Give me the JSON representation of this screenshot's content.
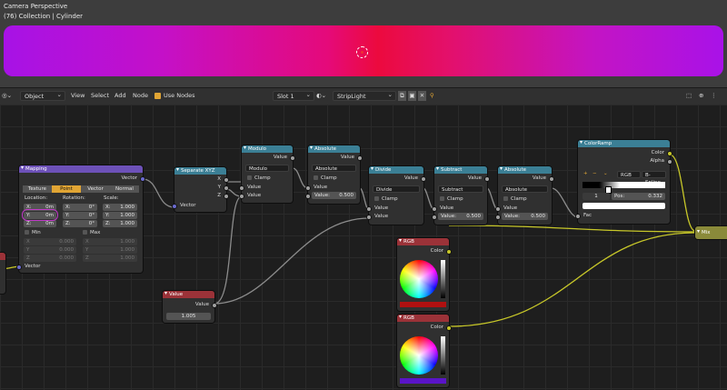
{
  "viewport": {
    "title": "Camera Perspective",
    "subtitle": "(76) Collection | Cylinder"
  },
  "header": {
    "mode": "Object",
    "menu_view": "View",
    "menu_select": "Select",
    "menu_add": "Add",
    "menu_node": "Node",
    "use_nodes": "Use Nodes",
    "slot": "Slot 1",
    "material": "StripLight"
  },
  "nodes": {
    "mapping": {
      "title": "Mapping",
      "out_vector": "Vector",
      "tabs": [
        "Texture",
        "Point",
        "Vector",
        "Normal"
      ],
      "col_location": "Location:",
      "col_rotation": "Rotation:",
      "col_scale": "Scale:",
      "loc": [
        [
          "X:",
          "0m"
        ],
        [
          "Y:",
          "0m"
        ],
        [
          "Z:",
          "0m"
        ]
      ],
      "rot": [
        [
          "X:",
          "0°"
        ],
        [
          "Y:",
          "0°"
        ],
        [
          "Z:",
          "0°"
        ]
      ],
      "scale": [
        [
          "X:",
          "1.000"
        ],
        [
          "Y:",
          "1.000"
        ],
        [
          "Z:",
          "1.000"
        ]
      ],
      "min": "Min",
      "max": "Max",
      "min_vals": [
        [
          "X",
          "0.000"
        ],
        [
          "Y",
          "0.000"
        ],
        [
          "Z",
          "0.000"
        ]
      ],
      "max_vals": [
        [
          "X",
          "1.000"
        ],
        [
          "Y",
          "1.000"
        ],
        [
          "Z",
          "1.000"
        ]
      ],
      "in_vector": "Vector"
    },
    "separate": {
      "title": "Separate XYZ",
      "out_x": "X",
      "out_y": "Y",
      "out_z": "Z",
      "in_vector": "Vector"
    },
    "modulo": {
      "title": "Modulo",
      "out": "Value",
      "op": "Modulo",
      "clamp": "Clamp",
      "in1": "Value",
      "in2": "Value"
    },
    "absolute1": {
      "title": "Absolute",
      "out": "Value",
      "op": "Absolute",
      "clamp": "Clamp",
      "in1": "Value",
      "in2_label": "Value:",
      "in2_val": "0.500"
    },
    "divide": {
      "title": "Divide",
      "out": "Value",
      "op": "Divide",
      "clamp": "Clamp",
      "in1": "Value",
      "in2": "Value"
    },
    "subtract": {
      "title": "Subtract",
      "out": "Value",
      "op": "Subtract",
      "clamp": "Clamp",
      "in1": "Value",
      "in2_label": "Value:",
      "in2_val": "0.500"
    },
    "absolute2": {
      "title": "Absolute",
      "out": "Value",
      "op": "Absolute",
      "clamp": "Clamp",
      "in1": "Value",
      "in2_label": "Value:",
      "in2_val": "0.500"
    },
    "colorramp": {
      "title": "ColorRamp",
      "out_color": "Color",
      "out_alpha": "Alpha",
      "mode": "RGB",
      "interp": "B-Spline",
      "index": "1",
      "pos_label": "Pos:",
      "pos_val": "0.332",
      "in_fac": "Fac"
    },
    "value": {
      "title": "Value",
      "out": "Value",
      "val": "1.005"
    },
    "rgb1": {
      "title": "RGB",
      "out": "Color",
      "swatch": "#b01010"
    },
    "rgb2": {
      "title": "RGB",
      "out": "Color",
      "swatch": "#5a14c8"
    },
    "mix": {
      "title": "Mix"
    }
  }
}
